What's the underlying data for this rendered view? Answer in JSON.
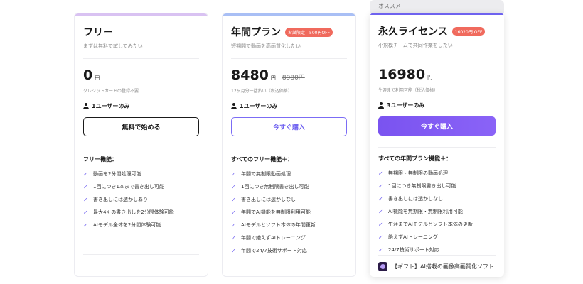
{
  "ribbon_label": "オススメ",
  "colors": {
    "free_topbar": "#d9c2f2",
    "annual_topbar": "#a9bff5",
    "life_topbar": "#6e62ef",
    "accent": "#6a5cf0",
    "badge": "#f06a5d"
  },
  "plans": {
    "free": {
      "title": "フリー",
      "subtitle": "まずは無料で試してみたい",
      "price": "0",
      "unit": "円",
      "note": "クレジットカードの登録不要",
      "users": "1ユーザーのみ",
      "cta": "無料で始める",
      "features_head": "フリー機能：",
      "features": [
        "動画を2分間処理可能",
        "1回につき1本まで書き出し可能",
        "書き出しには透かしあり",
        "最大4K の書き出しを2分間体験可能",
        "AIモデル全体を2分間体験可能"
      ]
    },
    "annual": {
      "title": "年間プラン",
      "badge": "お試限定：500円OFF",
      "subtitle": "短期間で動画を高画質化したい",
      "price": "8480",
      "unit": "円",
      "original_price": "8980円",
      "note": "12ヶ月分一括払い（税込価格）",
      "users": "1ユーザーのみ",
      "cta": "今すぐ購入",
      "features_head": "すべてのフリー機能＋：",
      "features": [
        "年間で無制限動画処理",
        "1回につき無制限書き出し可能",
        "書き出しには透かしなし",
        "年間でAI機能を無制限利用可能",
        "AIモデルとソフト本体の年間更新",
        "年間で絶えずAIトレーニング",
        "年間で24/7技術サポート対応"
      ]
    },
    "life": {
      "title": "永久ライセンス",
      "badge": "16020円 OFF",
      "subtitle": "小規模チームで共同作業をしたい",
      "price": "16980",
      "unit": "円",
      "note": "生涯まで利用可能（税込価格）",
      "users": "3ユーザーのみ",
      "cta": "今すぐ購入",
      "features_head": "すべての年間プラン機能＋：",
      "features": [
        "無期限・無制限の動画処理",
        "1回につき無制限書き出し可能",
        "書き出しには透かしなし",
        "AI機能を無期限・無制限利用可能",
        "生涯までAIモデルとソフト本体の更新",
        "絶えずAIトレーニング",
        "24/7技術サポート対応"
      ],
      "gift": "【ギフト】AI搭載の画像高画質化ソフト"
    }
  }
}
